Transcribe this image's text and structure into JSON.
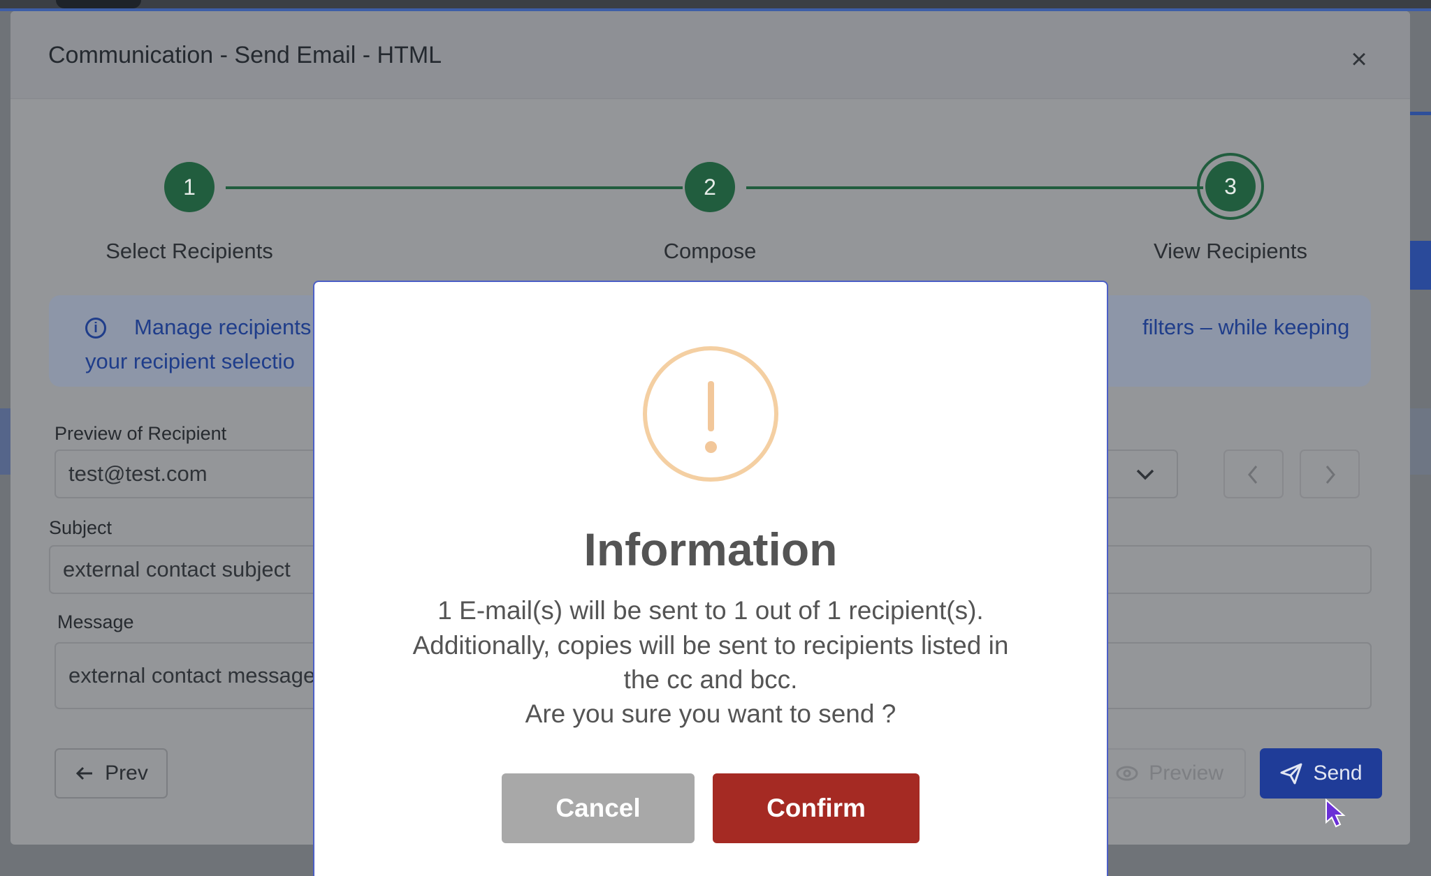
{
  "window": {
    "title": "Communication - Send Email - HTML",
    "close_label": "×"
  },
  "stepper": {
    "steps": [
      {
        "number": "1",
        "label": "Select Recipients",
        "state": "completed"
      },
      {
        "number": "2",
        "label": "Compose",
        "state": "completed"
      },
      {
        "number": "3",
        "label": "View Recipients",
        "state": "active"
      }
    ]
  },
  "info_banner": {
    "icon": "info-icon",
    "line1_left": "Manage recipients",
    "line1_right": "filters – while keeping",
    "line2_left": "your recipient selectio"
  },
  "form": {
    "preview_label": "Preview of Recipient",
    "preview_value": "test@test.com",
    "subject_label": "Subject",
    "subject_value": "external contact subject",
    "message_label": "Message",
    "message_value": "external contact message"
  },
  "footer": {
    "prev_label": "Prev",
    "preview_label": "Preview",
    "send_label": "Send"
  },
  "dialog": {
    "title": "Information",
    "line1": "1 E-mail(s) will be sent to 1 out of 1 recipient(s).",
    "line2": "Additionally, copies will be sent to recipients listed in",
    "line3": "the cc and bcc.",
    "line4": "Are you sure you want to send ?",
    "cancel_label": "Cancel",
    "confirm_label": "Confirm"
  },
  "colors": {
    "step_green": "#215d3e",
    "send_blue": "#1f3c98",
    "confirm_red": "#a52a23",
    "cancel_gray": "#a8a8a8",
    "warning_orange": "#f4cfa2"
  }
}
